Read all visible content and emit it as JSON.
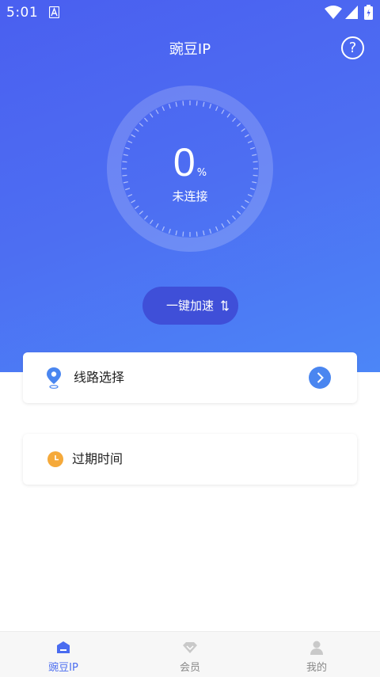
{
  "status_bar": {
    "time": "5:01",
    "icons": [
      "notification-a-icon",
      "wifi-icon",
      "signal-icon",
      "battery-icon"
    ]
  },
  "header": {
    "title": "豌豆IP",
    "help_icon": "question-circle-icon",
    "help_glyph": "?"
  },
  "dial": {
    "value": "0",
    "unit": "%",
    "status": "未连接"
  },
  "accelerate_button": {
    "label": "一键加速",
    "icon": "swap-arrows-icon"
  },
  "cards": {
    "route": {
      "label": "线路选择",
      "icon": "location-pin-icon",
      "action_icon": "chevron-right-circle-icon"
    },
    "expire": {
      "label": "过期时间",
      "icon": "clock-icon"
    }
  },
  "tabbar": {
    "items": [
      {
        "label": "豌豆IP",
        "icon": "home-icon",
        "active": true
      },
      {
        "label": "会员",
        "icon": "diamond-icon",
        "active": false
      },
      {
        "label": "我的",
        "icon": "person-icon",
        "active": false
      }
    ]
  },
  "colors": {
    "gradient_start": "#4a5ff0",
    "gradient_end": "#4c86f7",
    "button_dark": "#3f4fd8",
    "accent_blue": "#4a6cf0",
    "clock_orange": "#f5a93a",
    "tab_inactive": "#888888"
  }
}
